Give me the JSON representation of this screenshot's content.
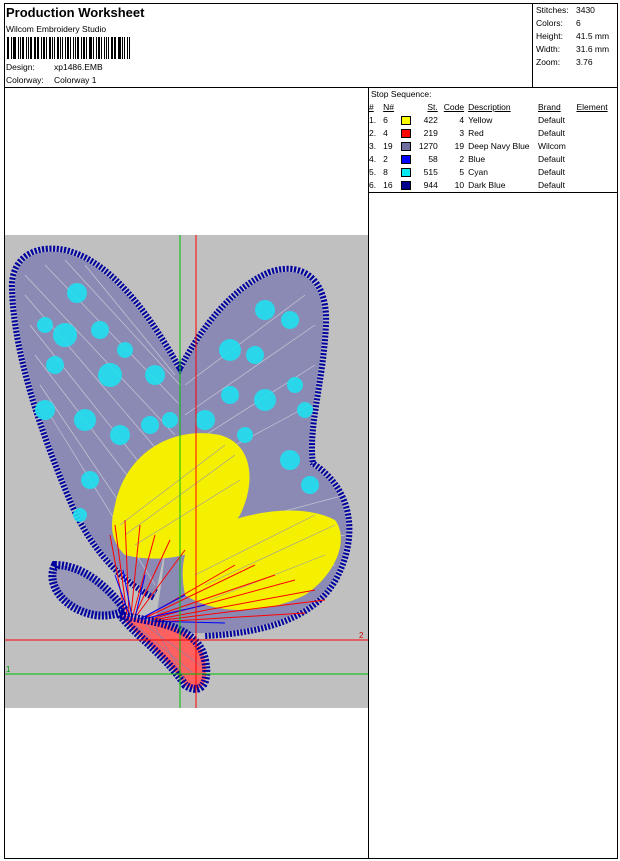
{
  "header": {
    "title": "Production Worksheet",
    "software": "Wilcom Embroidery Studio",
    "design_label": "Design:",
    "design_value": "xp1486.EMB",
    "colorway_label": "Colorway:",
    "colorway_value": "Colorway 1"
  },
  "stats": [
    {
      "label": "Stitches:",
      "value": "3430"
    },
    {
      "label": "Colors:",
      "value": "6"
    },
    {
      "label": "Height:",
      "value": "41.5 mm"
    },
    {
      "label": "Width:",
      "value": "31.6 mm"
    },
    {
      "label": "Zoom:",
      "value": "3.76"
    }
  ],
  "stop_sequence": {
    "title": "Stop Sequence:",
    "headers": {
      "seq": "#",
      "n": "N#",
      "st": "St.",
      "code": "Code",
      "desc": "Description",
      "brand": "Brand",
      "element": "Element"
    },
    "rows": [
      {
        "seq": "1.",
        "n": "6",
        "color": "#ffff00",
        "st": "422",
        "code": "4",
        "desc": "Yellow",
        "brand": "Default"
      },
      {
        "seq": "2.",
        "n": "4",
        "color": "#ff0000",
        "st": "219",
        "code": "3",
        "desc": "Red",
        "brand": "Default"
      },
      {
        "seq": "3.",
        "n": "19",
        "color": "#7070a0",
        "st": "1270",
        "code": "19",
        "desc": "Deep Navy Blue",
        "brand": "Wilcom"
      },
      {
        "seq": "4.",
        "n": "2",
        "color": "#0000ff",
        "st": "58",
        "code": "2",
        "desc": "Blue",
        "brand": "Default"
      },
      {
        "seq": "5.",
        "n": "8",
        "color": "#00e8f0",
        "st": "515",
        "code": "5",
        "desc": "Cyan",
        "brand": "Default"
      },
      {
        "seq": "6.",
        "n": "16",
        "color": "#00008c",
        "st": "944",
        "code": "10",
        "desc": "Dark Blue",
        "brand": "Default"
      }
    ]
  },
  "design_preview": {
    "axis_labels": {
      "red": "2",
      "green": "1"
    },
    "colors": {
      "background": "#c0c0c0",
      "outline": "#0000a0",
      "fill": "#8080b0",
      "cyan": "#20e0f0",
      "yellow": "#ffff00",
      "red": "#ff0000",
      "blue": "#0000ff",
      "guide_red": "#ff0000",
      "guide_green": "#00c000"
    }
  }
}
